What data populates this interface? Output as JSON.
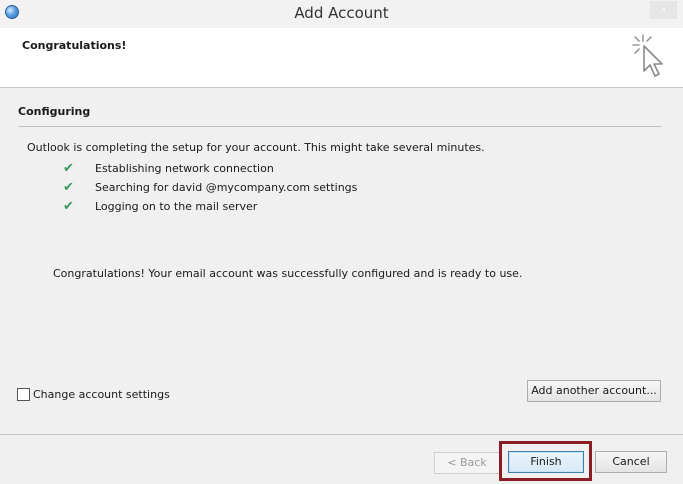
{
  "window": {
    "title": "Add Account",
    "close_glyph": "✕"
  },
  "header": {
    "title": "Congratulations!",
    "icon": "cursor-click-icon"
  },
  "body": {
    "section_title": "Configuring",
    "intro": "Outlook is completing the setup for your account. This might take several minutes.",
    "steps": [
      {
        "label": "Establishing network connection",
        "status": "done"
      },
      {
        "label": "Searching for david @mycompany.com settings",
        "status": "done"
      },
      {
        "label": "Logging on to the mail server",
        "status": "done"
      }
    ],
    "check_glyph": "✔",
    "success_message": "Congratulations! Your email account was successfully configured and is ready to use.",
    "change_settings": {
      "label": "Change account settings",
      "checked": false
    },
    "add_another_label": "Add another account..."
  },
  "footer": {
    "back_label": "< Back",
    "finish_label": "Finish",
    "cancel_label": "Cancel"
  },
  "colors": {
    "check": "#3a9a5a",
    "highlight_border": "#8b1d24"
  }
}
